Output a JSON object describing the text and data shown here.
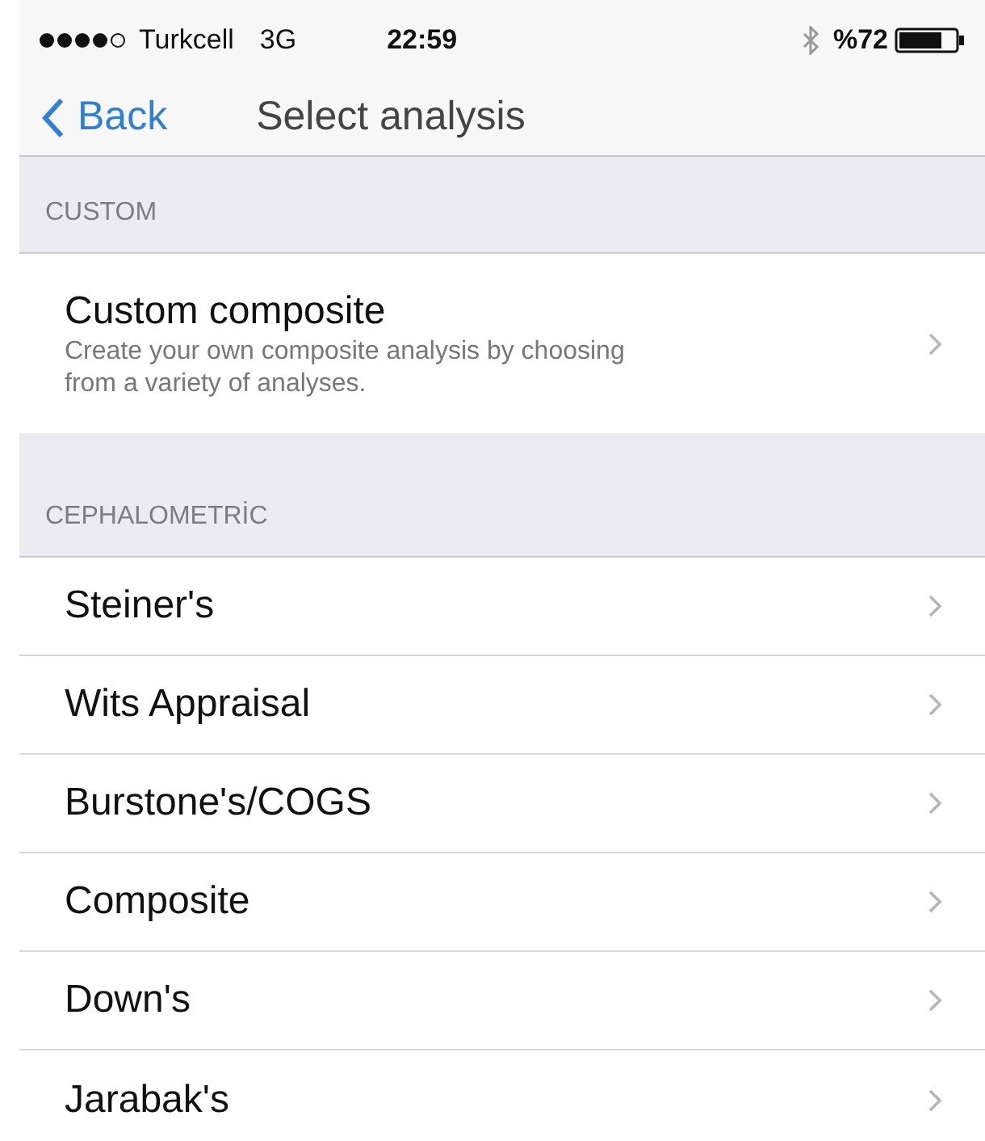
{
  "status_bar": {
    "carrier": "Turkcell",
    "network": "3G",
    "time": "22:59",
    "battery": "%72"
  },
  "nav": {
    "back": "Back",
    "title": "Select analysis"
  },
  "sections": [
    {
      "header": "CUSTOM",
      "items": [
        {
          "title": "Custom composite",
          "subtitle": "Create your own composite analysis by choosing from a variety of analyses."
        }
      ]
    },
    {
      "header": "CEPHALOMETRİC",
      "items": [
        {
          "title": "Steiner's"
        },
        {
          "title": "Wits Appraisal"
        },
        {
          "title": "Burstone's/COGS"
        },
        {
          "title": "Composite"
        },
        {
          "title": "Down's"
        },
        {
          "title": "Jarabak's"
        }
      ]
    }
  ]
}
